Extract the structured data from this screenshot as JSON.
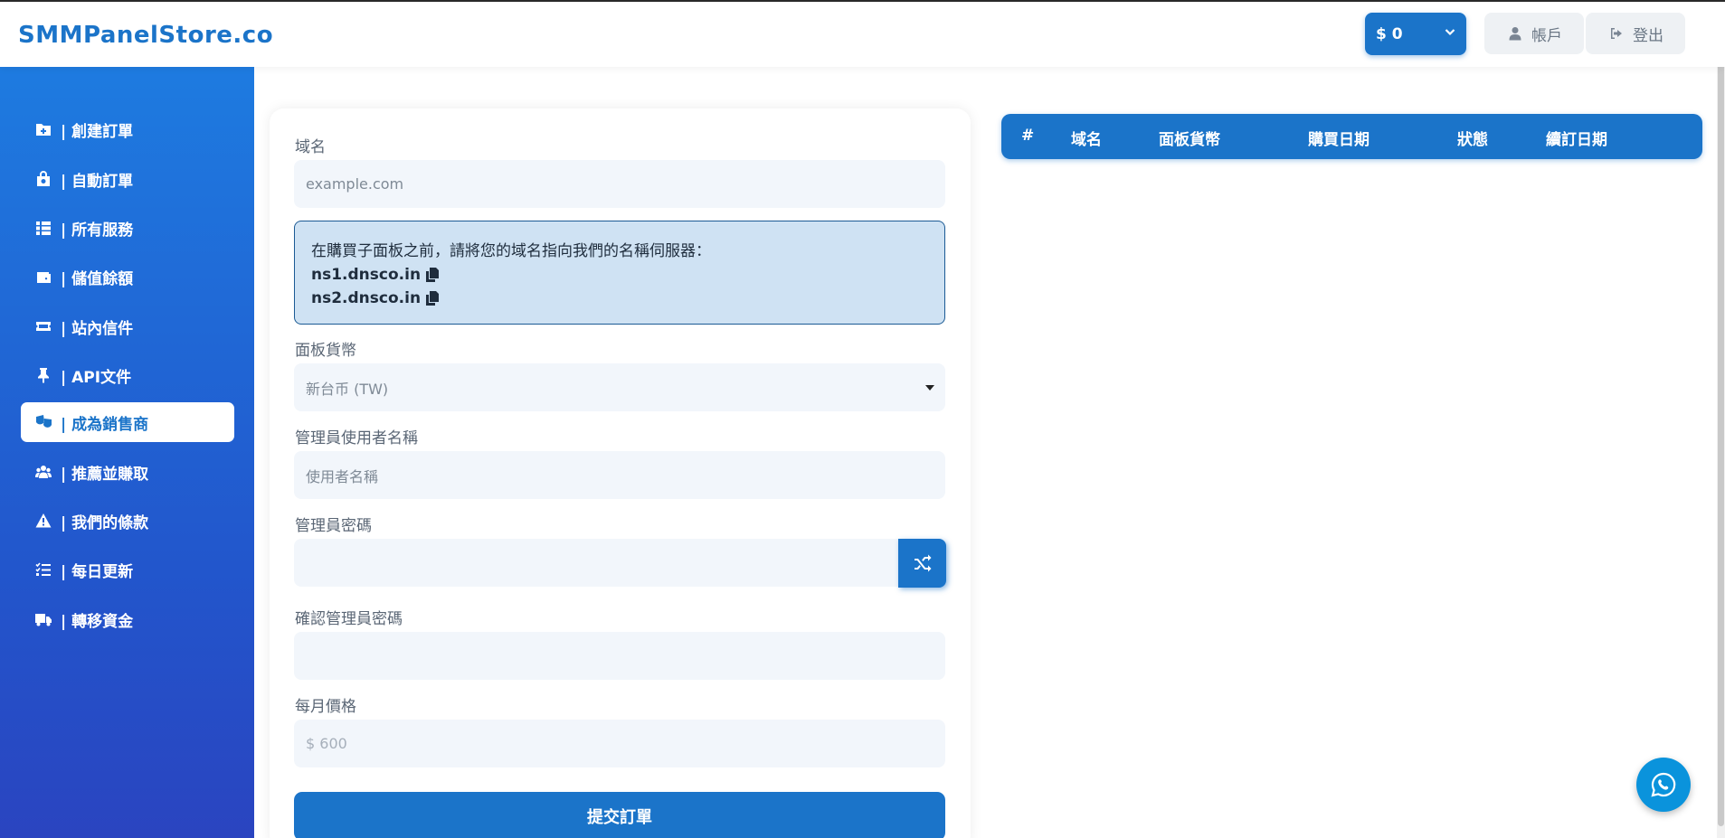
{
  "brand": "SMMPanelStore.co",
  "header": {
    "balance": "$ 0",
    "account_label": "帳戶",
    "logout_label": "登出"
  },
  "sidebar": {
    "items": [
      {
        "label": "| 創建訂單",
        "icon": "plus-square-icon"
      },
      {
        "label": "| 自動訂單",
        "icon": "bag-icon"
      },
      {
        "label": "| 所有服務",
        "icon": "list-table-icon"
      },
      {
        "label": "| 儲值餘額",
        "icon": "wallet-icon"
      },
      {
        "label": "| 站內信件",
        "icon": "ticket-icon"
      },
      {
        "label": "| API文件",
        "icon": "pin-icon"
      },
      {
        "label": "| 成為銷售商",
        "icon": "masks-icon",
        "active": true
      },
      {
        "label": "| 推薦並賺取",
        "icon": "users-icon"
      },
      {
        "label": "| 我們的條款",
        "icon": "warning-icon"
      },
      {
        "label": "| 每日更新",
        "icon": "checklist-icon"
      },
      {
        "label": "| 轉移資金",
        "icon": "truck-icon"
      }
    ]
  },
  "form": {
    "domain_label": "域名",
    "domain_placeholder": "example.com",
    "info_text": "在購買子面板之前，請將您的域名指向我們的名稱伺服器：",
    "ns1": "ns1.dnsco.in",
    "ns2": "ns2.dnsco.in",
    "currency_label": "面板貨幣",
    "currency_value": "新台币 (TW)",
    "admin_user_label": "管理員使用者名稱",
    "admin_user_placeholder": "使用者名稱",
    "admin_pass_label": "管理員密碼",
    "confirm_pass_label": "確認管理員密碼",
    "price_label": "每月價格",
    "price_value": "$ 600",
    "submit_label": "提交訂單"
  },
  "table": {
    "columns": [
      "#",
      "域名",
      "面板貨幣",
      "購買日期",
      "狀態",
      "續訂日期"
    ]
  },
  "colors": {
    "primary": "#1b74c9",
    "sidebar_top": "#1e7be0",
    "sidebar_bottom": "#2a44c0"
  }
}
